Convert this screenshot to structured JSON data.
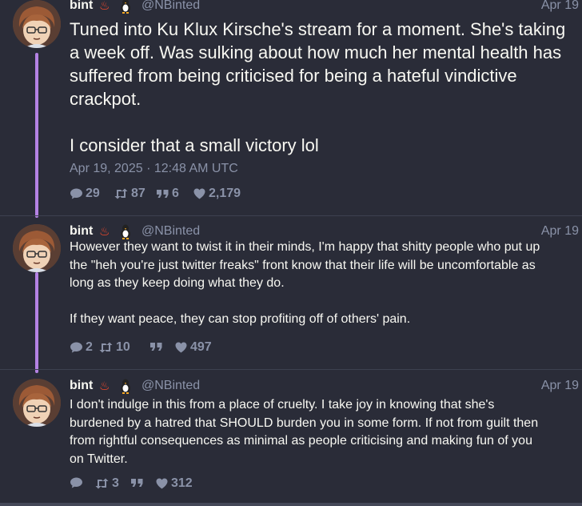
{
  "tweets": [
    {
      "fullname": "bint",
      "username": "@NBinted",
      "date": "Apr 19",
      "content": "Tuned into Ku Klux Kirsche's stream for a moment. She's taking\na week off. Was sulking about how much her mental health has\nsuffered from being criticised for being a hateful vindictive\ncrackpot.\n\nI consider that a small victory lol",
      "published": "Apr 19, 2025 · 12:48 AM UTC",
      "stats": {
        "replies": "29",
        "retweets": "87",
        "quotes": "6",
        "likes": "2,179"
      }
    },
    {
      "fullname": "bint",
      "username": "@NBinted",
      "date": "Apr 19",
      "content": "However they want to twist it in their minds, I'm happy that shitty people who put up\nthe \"heh you're just twitter freaks\" front know that their life will be uncomfortable as\nlong as they keep doing what they do.\n\nIf they want peace, they can stop profiting off of others' pain.",
      "stats": {
        "replies": "2",
        "retweets": "10",
        "quotes": "",
        "likes": "497"
      }
    },
    {
      "fullname": "bint",
      "username": "@NBinted",
      "date": "Apr 19",
      "content": "I don't indulge in this from a place of cruelty. I take joy in knowing that she's\nburdened by a hatred that SHOULD burden you in some form. If not from guilt then\nfrom rightful consequences as minimal as people criticising and making fun of you\non Twitter.",
      "stats": {
        "replies": "",
        "retweets": "3",
        "quotes": "",
        "likes": "312"
      }
    }
  ],
  "icons": {
    "reply": "comment-icon",
    "retweet": "retweet-icon",
    "quote": "quote-icon",
    "like": "heart-icon"
  },
  "colors": {
    "background": "#2a2c38",
    "thread_line": "#b482e3",
    "text": "#f8f8f2",
    "muted": "#8a92a8"
  }
}
